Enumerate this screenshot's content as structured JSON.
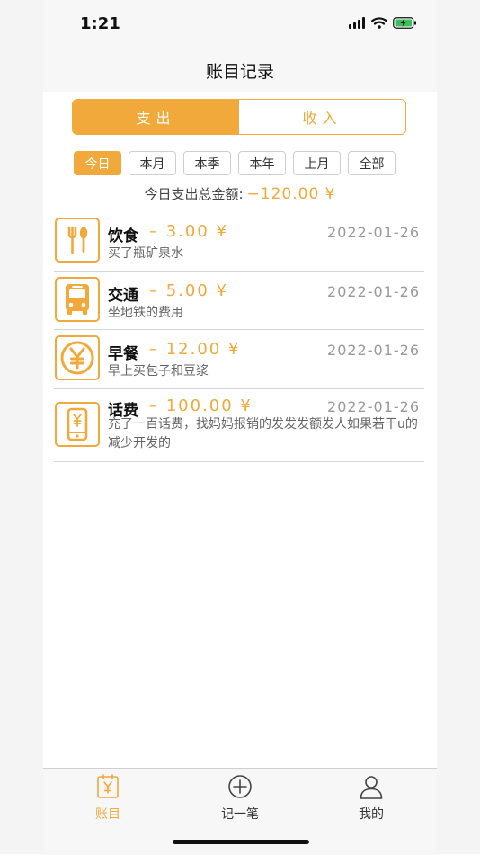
{
  "status": {
    "time": "1:21"
  },
  "nav": {
    "title": "账目记录"
  },
  "segment": {
    "expense": "支出",
    "income": "收入"
  },
  "filters": [
    "今日",
    "本月",
    "本季",
    "本年",
    "上月",
    "全部"
  ],
  "summary": {
    "label": "今日支出总金额:",
    "amount": "−120.00 ¥"
  },
  "records": [
    {
      "category": "饮食",
      "amount": "– 3.00 ¥",
      "date": "2022-01-26",
      "note": "买了瓶矿泉水",
      "icon": "utensils-icon"
    },
    {
      "category": "交通",
      "amount": "– 5.00 ¥",
      "date": "2022-01-26",
      "note": "坐地铁的费用",
      "icon": "bus-icon"
    },
    {
      "category": "早餐",
      "amount": "– 12.00 ¥",
      "date": "2022-01-26",
      "note": "早上买包子和豆浆",
      "icon": "yen-coin-icon"
    },
    {
      "category": "话费",
      "amount": "– 100.00 ¥",
      "date": "2022-01-26",
      "note": "充了一百话费，找妈妈报销的发发发额发人如果若干u的减少开发的",
      "icon": "phone-yen-icon"
    }
  ],
  "tabs": [
    {
      "label": "账目",
      "icon": "ledger-icon",
      "active": true
    },
    {
      "label": "记一笔",
      "icon": "add-circle-icon",
      "active": false
    },
    {
      "label": "我的",
      "icon": "person-icon",
      "active": false
    }
  ],
  "colors": {
    "accent": "#f0a93a",
    "background": "#ffffff",
    "bar": "#f7f7f7",
    "battery": "#38c15a"
  }
}
